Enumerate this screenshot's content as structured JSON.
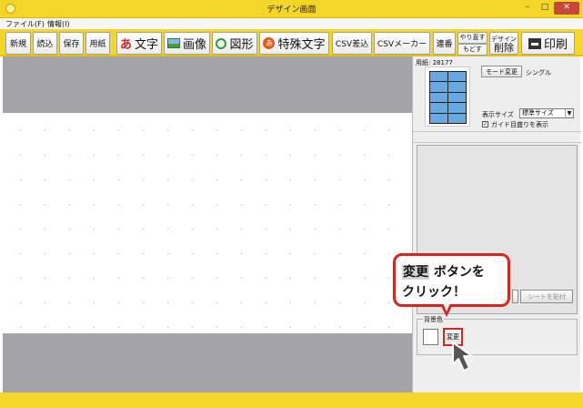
{
  "window": {
    "title": "デザイン画面",
    "minimize": "–",
    "maximize": "□",
    "close": "✕"
  },
  "menu": {
    "file": "ファイル(F)",
    "info": "情報(I)"
  },
  "toolbar": {
    "new": "新規",
    "open": "読込",
    "save": "保存",
    "paper": "用紙",
    "text_icon": "あ",
    "text": "文字",
    "image": "画像",
    "shape": "図形",
    "special_text_icon": "あ",
    "special_text": "特殊文字",
    "csv_insert": "CSV差込",
    "csv_maker": "CSVメーカー",
    "serial": "連番",
    "redo": "やり直す",
    "undo": "もどす",
    "design_delete_small": "デザイン",
    "design_delete": "削除",
    "print": "印刷"
  },
  "panel": {
    "paper_label": "用紙: 28177",
    "mode_change": "モード変更",
    "mode": "シングル",
    "display_size_label": "表示サイズ",
    "display_size_value": "標準サイズ",
    "guide_checked": "✓",
    "guide_label": "ガイド目盛りを表示",
    "sheet_paste": "シートを貼付",
    "background_label": "背景色",
    "change_button": "変更"
  },
  "callout": {
    "highlight": "変更",
    "line1_rest": " ボタンを",
    "line2": "クリック！"
  }
}
